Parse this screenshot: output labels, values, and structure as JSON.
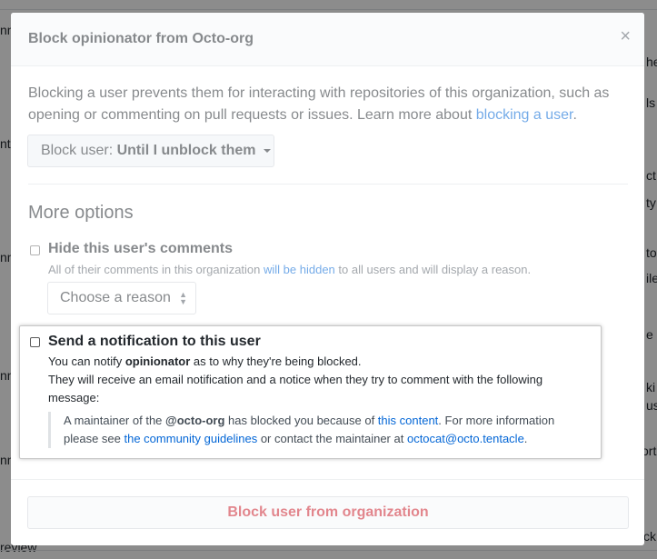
{
  "background": {
    "fragments": [
      "nn",
      "he",
      "nt",
      "ls",
      "ct",
      "ty",
      "nn",
      "to",
      "ile",
      "nn",
      "e",
      "ki",
      "us",
      "ort",
      "nn",
      "review",
      "ck"
    ]
  },
  "modal": {
    "title": "Block opinionator from Octo-org",
    "close_label": "×",
    "intro_text": "Blocking a user prevents them for interacting with repositories of this organization, such as opening or commenting on pull requests or issues. Learn more about ",
    "intro_link": "blocking a user",
    "intro_end": ".",
    "block_select": {
      "prefix": "Block user:",
      "value": "Until I unblock them"
    },
    "more_options_heading": "More options",
    "hide_comments": {
      "label": "Hide this user's comments",
      "note_start": "All of their comments in this organization ",
      "note_link": "will be hidden",
      "note_end": " to all users and will display a reason.",
      "reason_placeholder": "Choose a reason"
    },
    "notification": {
      "label": "Send a notification to this user",
      "line1_start": "You can notify ",
      "line1_user": "opinionator",
      "line1_end": " as to why they're being blocked.",
      "line2": "They will receive an email notification and a notice when they try to comment with the following",
      "line3": "message:",
      "quote_start": "A maintainer of the ",
      "quote_org": "@octo-org",
      "quote_mid": " has blocked you because of ",
      "quote_link1": "this content",
      "quote_mid2": ". For more information please see ",
      "quote_link2": "the community guidelines",
      "quote_mid3": " or contact the maintainer at ",
      "quote_link3": "octocat@octo.tentacle",
      "quote_end": "."
    },
    "submit_button": "Block user from organization"
  },
  "colors": {
    "link": "#0366d6",
    "danger": "#cb2431",
    "header_bg": "#f6f8fa"
  }
}
